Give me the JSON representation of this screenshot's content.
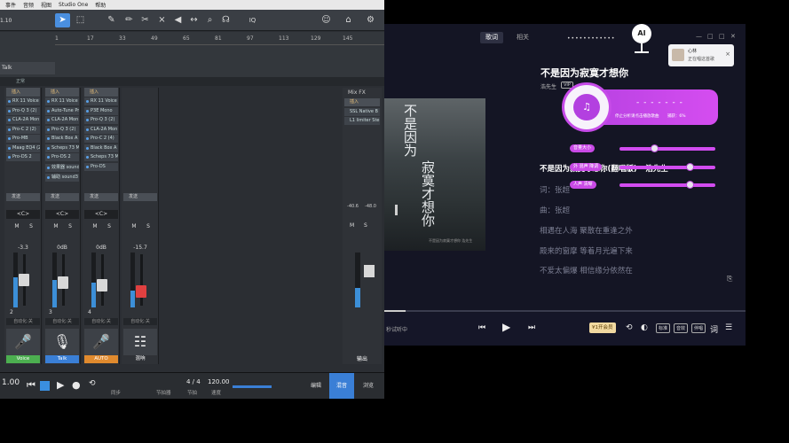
{
  "daw": {
    "menu": [
      "事件",
      "音频",
      "视图",
      "Studio One",
      "帮助"
    ],
    "toolbar_icons": [
      "arrow-tool-icon",
      "range-tool-icon",
      "eraser-icon",
      "pencil-icon",
      "scissors-icon",
      "mute-tool-icon",
      "speaker-icon",
      "bend-icon",
      "zoom-icon",
      "listen-icon",
      "iq-icon",
      "user-icon",
      "home-icon",
      "settings-icon"
    ],
    "lcd": "1.10",
    "ruler_marks": [
      "1",
      "17",
      "33",
      "49",
      "65",
      "81",
      "97",
      "113",
      "129",
      "145"
    ],
    "track_name": "Talk",
    "mix_mode": "正常",
    "strips": [
      {
        "insert_label": "插入",
        "slots": [
          "RX 11 Voice",
          "Pro-Q 3 (2)",
          "CLA-2A Mon",
          "Pro-C 2 (2)",
          "Pro-MB",
          "Maag EQ4 (2)",
          "Pro-DS 2"
        ],
        "send": "发送",
        "pan": "<C>",
        "value": "-3.3",
        "channel": "2",
        "auto": "自动化:关",
        "name": "Voice",
        "name_color": "#4caf50",
        "fill": 0.55,
        "icon": "microphone-icon"
      },
      {
        "insert_label": "插入",
        "slots": [
          "RX 11 Voice",
          "Auto-Tune Pr",
          "CLA-2A Mon",
          "Pro-Q 3 (2)",
          "Black Box A",
          "Scheps 73 M",
          "Pro-DS 2"
        ],
        "send": "发送",
        "pan": "<C>",
        "value": "0dB",
        "channel": "3",
        "auto": "自动化:关",
        "name": "Talk",
        "name_color": "#3a7fd6",
        "fill": 0.5,
        "icon": "dual-microphone-icon"
      },
      {
        "insert_label": "插入",
        "slots": [
          "RX 11 Voice",
          "P3E Mono",
          "Pro-Q 3 (2)",
          "CLA-2A Mon",
          "Pro-C 2 (4)",
          "Black Box A",
          "Scheps 73 M",
          "Pro-DS"
        ],
        "send": "发送",
        "pan": "<C>",
        "value": "0dB",
        "channel": "4",
        "auto": "自动化:关",
        "name": "AUTO",
        "name_color": "#e08a2e",
        "fill": 0.45,
        "icon": "microphone-icon"
      },
      {
        "insert_label": "",
        "slots": [],
        "send": "发送",
        "pan": "",
        "value": "-15.7",
        "channel": "",
        "auto": "自动化:关",
        "name": "混响",
        "name_color": "#2f3237",
        "fill": 0.3,
        "icon": "mixer-icon"
      }
    ],
    "extra_slots": [
      "效果器 sound3",
      "辅助 sound3"
    ],
    "mixfx": {
      "title": "Mix FX",
      "insert_label": "插入",
      "slots": [
        "SSL Native B",
        "L1 limiter Ste"
      ],
      "value": "-40.6",
      "value2": "-48.0",
      "name": "输出",
      "fill": 0.35
    },
    "transport": {
      "time": "1.00",
      "sig": "4 / 4",
      "sig_label": "节拍",
      "tempo": "120.00",
      "tempo_label": "速度",
      "sync_label": "同步",
      "metro_label": "节拍器",
      "time_label": "时间"
    },
    "nav": [
      "编辑",
      "混音",
      "浏览"
    ]
  },
  "player": {
    "tabs": [
      "歌词",
      "相关"
    ],
    "song_title": "不是因为寂寞才想你",
    "artist": "浩先生",
    "vip_badge": "VIP",
    "album_text": [
      "不是因为",
      "寂寞才想你"
    ],
    "album_credit": "不是因为寂寞才想你 浩先生",
    "lyrics": [
      {
        "text": "不是因为寂寞才想你(翻唱版) - 浩先生",
        "current": true
      },
      {
        "text": "词：张超",
        "current": false
      },
      {
        "text": "曲：张超",
        "current": false
      },
      {
        "text": "相遇在人海 聚散在重逢之外",
        "current": false
      },
      {
        "text": "殿来的窗摩 等着月光遍下来",
        "current": false
      },
      {
        "text": "不爱太偏爆 相信缘分依然在",
        "current": false
      }
    ],
    "ai_card": {
      "status": "停止分析请点击播放歌曲",
      "progress": "捕获：6%"
    },
    "mic_label": "AI",
    "sliders": [
      {
        "label": "音量大小",
        "level": 0.35
      },
      {
        "label": "外 混声 降调",
        "level": 0.75
      },
      {
        "label": "人声 清晰",
        "level": 0.75
      }
    ],
    "notify": {
      "name": "心林",
      "status": "正在唱这首歌",
      "close": "×"
    },
    "status_text": "秒试听中",
    "vip_button": "¥1开会员",
    "pills": [
      "标准",
      "音效",
      "伴唱"
    ],
    "bottom_icons": [
      "prev-icon",
      "play-icon",
      "next-icon",
      "repeat-icon",
      "lyrics-icon",
      "playlist-icon"
    ],
    "lyric_button": "词"
  }
}
